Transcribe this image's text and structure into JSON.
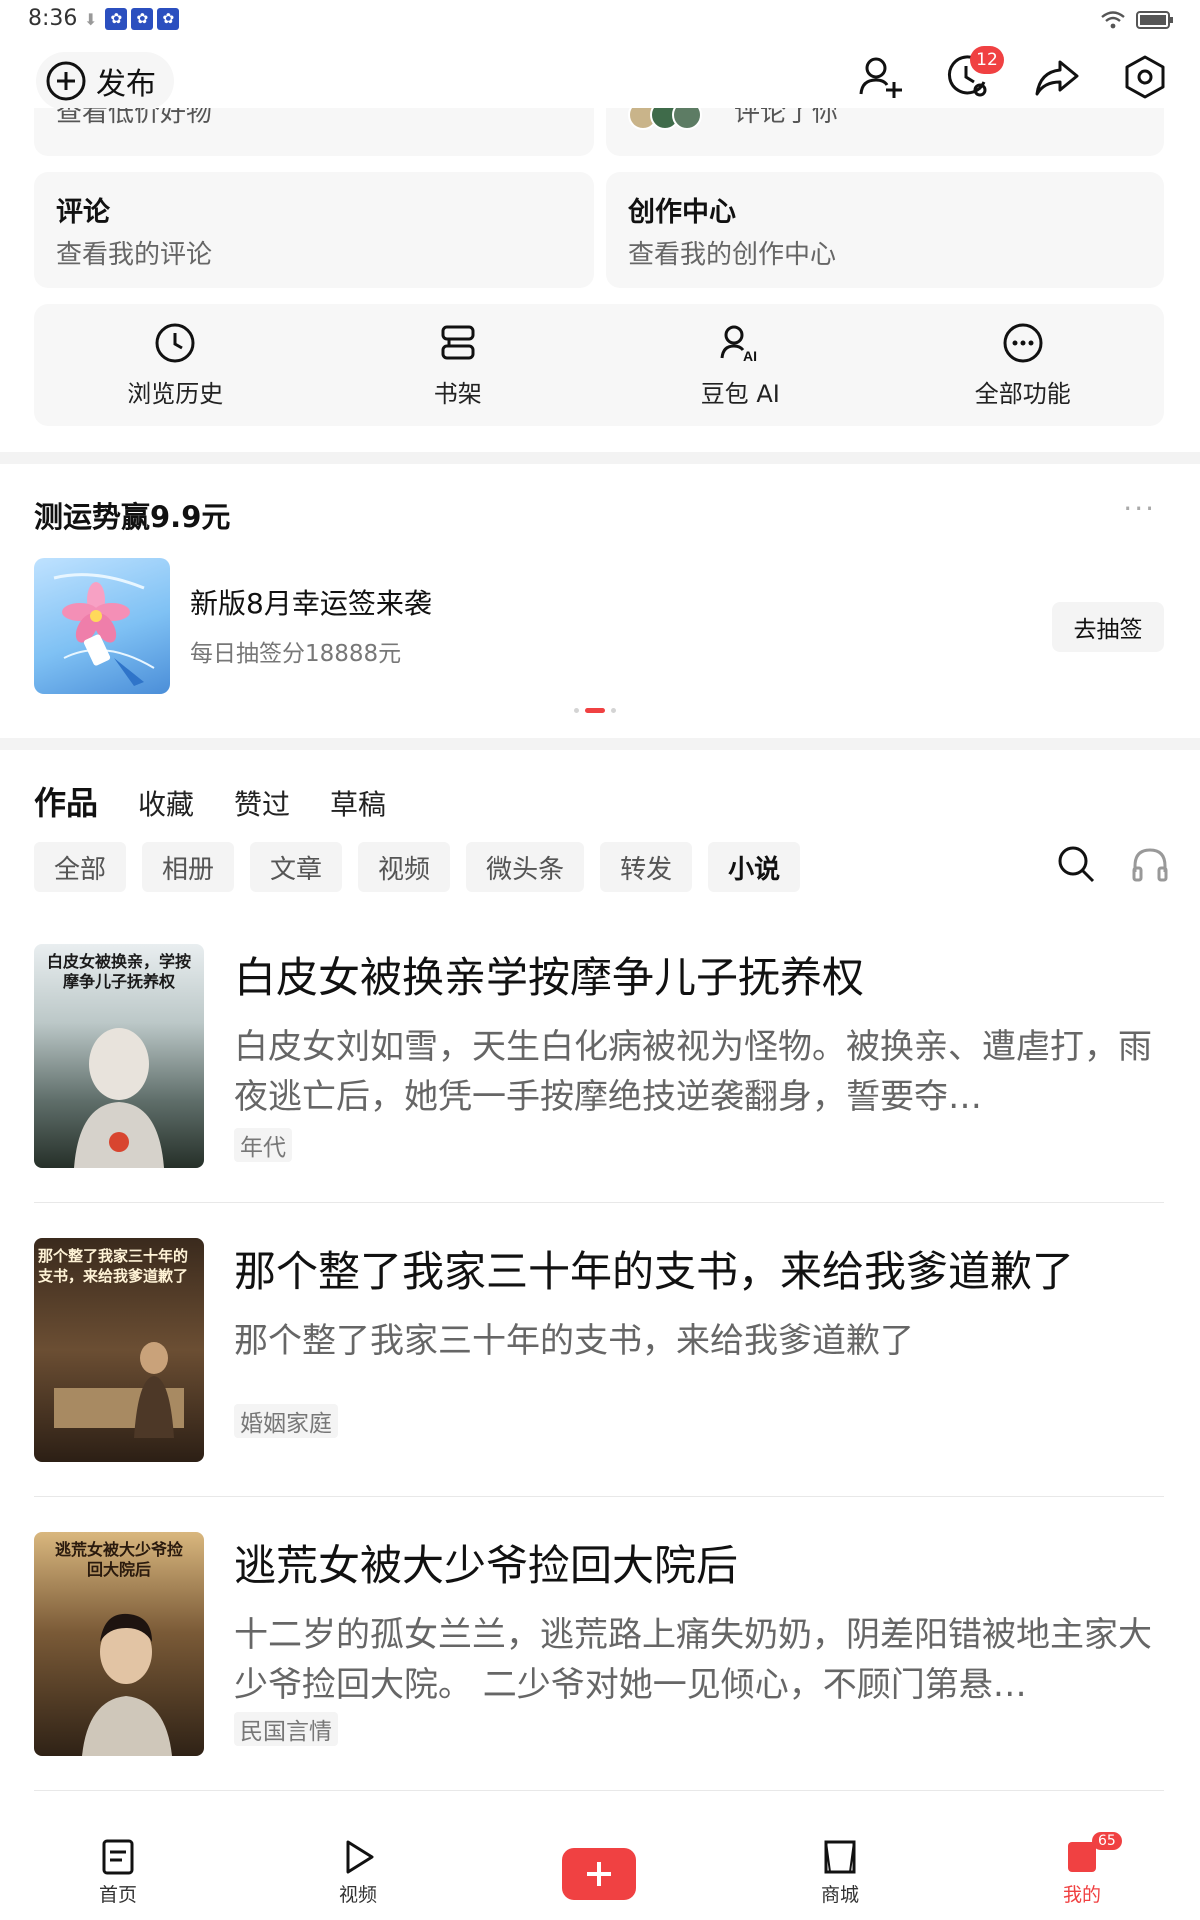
{
  "status": {
    "time": "8:36"
  },
  "header": {
    "publish_label": "发布",
    "notification_count": "12"
  },
  "cards_top": {
    "left_cut": "查看低价好物",
    "right_cut": "评论了你"
  },
  "cards": [
    {
      "title": "评论",
      "subtitle": "查看我的评论"
    },
    {
      "title": "创作中心",
      "subtitle": "查看我的创作中心"
    }
  ],
  "quick": [
    {
      "label": "浏览历史",
      "icon": "clock-icon"
    },
    {
      "label": "书架",
      "icon": "bookshelf-icon"
    },
    {
      "label": "豆包 AI",
      "icon": "doubao-ai-icon"
    },
    {
      "label": "全部功能",
      "icon": "more-circle-icon"
    }
  ],
  "fortune": {
    "title": "测运势赢9.9元",
    "more": "···",
    "name": "新版8月幸运签来袭",
    "sub": "每日抽签分18888元",
    "button": "去抽签"
  },
  "tabs": [
    "作品",
    "收藏",
    "赞过",
    "草稿"
  ],
  "filters": [
    "全部",
    "相册",
    "文章",
    "视频",
    "微头条",
    "转发",
    "小说"
  ],
  "items": [
    {
      "cover_text": "白皮女被换亲，学按摩争儿子抚养权",
      "title": "白皮女被换亲学按摩争儿子抚养权",
      "desc": "白皮女刘如雪，天生白化病被视为怪物。被换亲、遭虐打，雨夜逃亡后，她凭一手按摩绝技逆袭翻身，誓要夺…",
      "tag": "年代"
    },
    {
      "cover_text": "那个整了我家三十年的支书，来给我爹道歉了",
      "title": "那个整了我家三十年的支书，来给我爹道歉了",
      "desc": "那个整了我家三十年的支书，来给我爹道歉了",
      "tag": "婚姻家庭"
    },
    {
      "cover_text": "逃荒女被大少爷捡回大院后",
      "title": "逃荒女被大少爷捡回大院后",
      "desc": "十二岁的孤女兰兰，逃荒路上痛失奶奶，阴差阳错被地主家大少爷捡回大院。 二少爷对她一见倾心，不顾门第悬…",
      "tag": "民国言情"
    }
  ],
  "nav": {
    "home": "首页",
    "video": "视频",
    "mall": "商城",
    "mine": "我的",
    "mine_badge": "65"
  },
  "colors": {
    "accent": "#f04142",
    "card_bg": "#f7f7f7",
    "chip_bg": "#f4f4f4"
  }
}
